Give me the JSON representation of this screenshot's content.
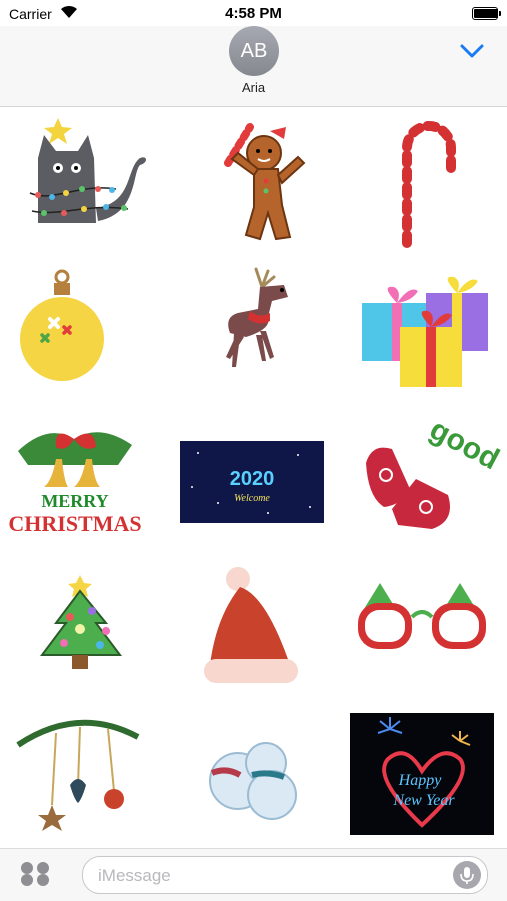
{
  "status_bar": {
    "carrier": "Carrier",
    "time": "4:58 PM",
    "battery_level": 1.0
  },
  "header": {
    "avatar_initials": "AB",
    "contact_name": "Aria"
  },
  "stickers": [
    {
      "name": "string-lights-cat"
    },
    {
      "name": "gingerbread-man"
    },
    {
      "name": "candy-cane"
    },
    {
      "name": "yellow-ornament"
    },
    {
      "name": "reindeer"
    },
    {
      "name": "gift-boxes"
    },
    {
      "name": "merry-christmas-bells",
      "text": [
        "MERRY",
        "CHRISTMAS"
      ]
    },
    {
      "name": "2020-welcome-card",
      "text": [
        "2020",
        "Welcome"
      ]
    },
    {
      "name": "mittens-good",
      "text": [
        "good"
      ]
    },
    {
      "name": "christmas-tree"
    },
    {
      "name": "santa-hat"
    },
    {
      "name": "tree-glasses"
    },
    {
      "name": "hanging-ornaments"
    },
    {
      "name": "snowmen"
    },
    {
      "name": "happy-new-year-fireworks",
      "text": [
        "Happy",
        "New Year"
      ]
    }
  ],
  "input_bar": {
    "placeholder": "iMessage"
  },
  "colors": {
    "accent": "#1a7bf4",
    "bar_background": "#f7f7f7",
    "placeholder": "#b8b8bd"
  }
}
